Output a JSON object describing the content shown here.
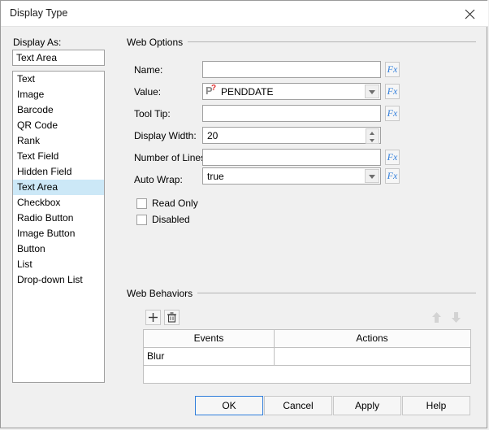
{
  "window": {
    "title": "Display Type",
    "close_icon": "close-icon"
  },
  "left_panel": {
    "label": "Display As:",
    "selected_value": "Text Area",
    "items": [
      "Text",
      "Image",
      "Barcode",
      "QR Code",
      "Rank",
      "Text Field",
      "Hidden Field",
      "Text Area",
      "Checkbox",
      "Radio Button",
      "Image Button",
      "Button",
      "List",
      "Drop-down List"
    ],
    "selected_index": 7
  },
  "web_options": {
    "title": "Web Options",
    "fx_label": "Fx",
    "fields": [
      {
        "label": "Name:",
        "value": "",
        "type": "text",
        "has_fx": true
      },
      {
        "label": "Value:",
        "value": "PENDDATE",
        "type": "combo",
        "has_fx": true,
        "icon": "parameter-icon"
      },
      {
        "label": "Tool Tip:",
        "value": "",
        "type": "text",
        "has_fx": true
      },
      {
        "label": "Display Width:",
        "value": "20",
        "type": "spinner",
        "has_fx": false
      },
      {
        "label": "Number of Lines:",
        "value": "",
        "type": "text",
        "has_fx": true
      },
      {
        "label": "Auto Wrap:",
        "value": "true",
        "type": "combo",
        "has_fx": true
      }
    ],
    "checkboxes": [
      {
        "label": "Read Only",
        "checked": false
      },
      {
        "label": "Disabled",
        "checked": false
      }
    ]
  },
  "web_behaviors": {
    "title": "Web Behaviors",
    "toolbar": {
      "add_icon": "plus-icon",
      "delete_icon": "trash-icon",
      "move_up_icon": "arrow-up-icon",
      "move_down_icon": "arrow-down-icon"
    },
    "columns": [
      "Events",
      "Actions"
    ],
    "rows": [
      {
        "event": "Blur",
        "action": ""
      }
    ]
  },
  "footer": {
    "buttons": [
      {
        "label": "OK",
        "default": true
      },
      {
        "label": "Cancel",
        "default": false
      },
      {
        "label": "Apply",
        "default": false
      },
      {
        "label": "Help",
        "default": false
      }
    ]
  },
  "colors": {
    "accent": "#2f7ddb",
    "selection": "#cce8f7",
    "dialog_bg": "#f0f0f0",
    "param_red": "#e03131"
  }
}
